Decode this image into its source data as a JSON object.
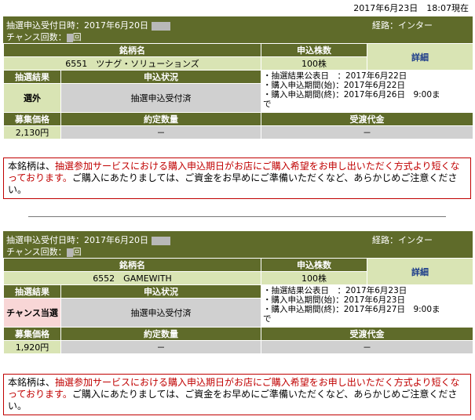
{
  "as_of": "2017年6月23日　18:07現在",
  "colors": {
    "header": "#5f6b2a",
    "cell": "#d9e4b4",
    "grey": "#d0d0d0",
    "notice_red": "#c00000",
    "win_bg": "#f8d6d6"
  },
  "labels": {
    "received_at": "抽選申込受付日時：2017年6月20日",
    "chance_count": "チャンス回数：",
    "chance_suffix": "回",
    "route": "経路：インター",
    "brand_name": "銘柄名",
    "shares": "申込株数",
    "detail": "詳細",
    "result": "抽選結果",
    "status": "申込状況",
    "price": "募集価格",
    "contract_qty": "約定数量",
    "settlement": "受渡代金"
  },
  "entries": [
    {
      "code_name": "6551　ツナグ・ソリューションズ",
      "shares": "100株",
      "result": "選外",
      "status": "抽選申込受付済",
      "date_lines": [
        "・抽選結果公表日　：2017年6月22日",
        "・購入申込期間(始)：2017年6月22日",
        "・購入申込期間(終)：2017年6月26日　9:00ま",
        "で"
      ],
      "price": "2,130円",
      "contract_qty": "－",
      "settlement": "－"
    },
    {
      "code_name": "6552　GAMEWITH",
      "shares": "100株",
      "result": "チャンス当選",
      "status": "抽選申込受付済",
      "date_lines": [
        "・抽選結果公表日　：2017年6月23日",
        "・購入申込期間(始)：2017年6月23日",
        "・購入申込期間(終)：2017年6月27日　9:00ま",
        "で"
      ],
      "price": "1,920円",
      "contract_qty": "－",
      "settlement": "－"
    }
  ],
  "notice": {
    "p1": "本銘柄は、",
    "p2": "抽選参加サービスにおける購入申込期日がお店にご購入希望をお申し出いただく方式より短くなっております。",
    "p3": "ご購入にあたりましては、ご資金をお早めにご準備いただくなど、あらかじめご注意ください。"
  }
}
